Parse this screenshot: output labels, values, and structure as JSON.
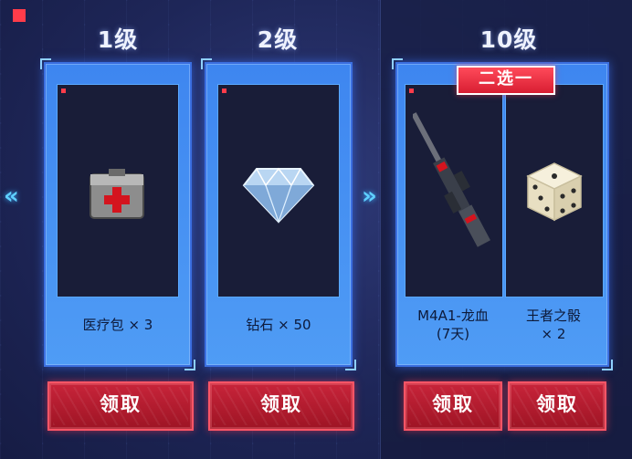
{
  "tiers": [
    {
      "level": "1级"
    },
    {
      "level": "2级"
    },
    {
      "level": "10级"
    }
  ],
  "rewards": {
    "tier1": {
      "name": "医疗包 × 3",
      "icon": "medkit-icon"
    },
    "tier2": {
      "name": "钻石 × 50",
      "icon": "diamond-icon"
    },
    "tier10_option1": {
      "name_line1": "M4A1-龙血",
      "name_line2": "(7天)",
      "icon": "rifle-icon"
    },
    "tier10_option2": {
      "name_line1": "王者之骰",
      "name_line2": "× 2",
      "icon": "dice-icon"
    }
  },
  "choose_badge": "二选一",
  "buttons": {
    "claim_label": "领取"
  },
  "nav": {
    "left": "«",
    "right": "»"
  },
  "colors": {
    "accent_red": "#d81e32",
    "frame_blue": "#3b6fe0",
    "background": "#1e2658"
  }
}
